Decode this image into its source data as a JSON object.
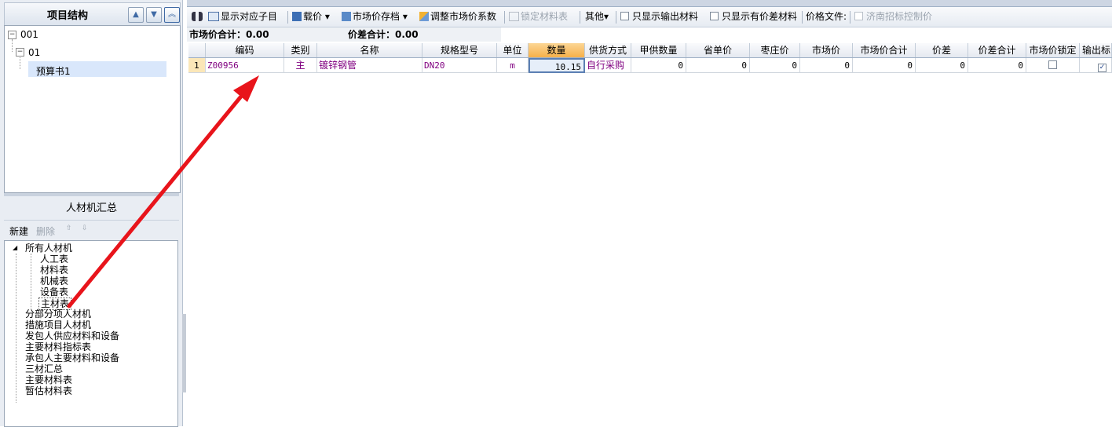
{
  "left_panel": {
    "project_header": "项目结构",
    "tree": [
      {
        "label": "001"
      },
      {
        "label": "01"
      },
      {
        "label": "预算书1"
      }
    ],
    "summary_header": "人材机汇总",
    "actions": {
      "new": "新建",
      "delete": "删除"
    },
    "summary_tree": {
      "root": "所有人材机",
      "children": [
        "人工表",
        "材料表",
        "机械表",
        "设备表",
        "主材表"
      ],
      "others": [
        "分部分项人材机",
        "措施项目人材机",
        "发包人供应材料和设备",
        "主要材料指标表",
        "承包人主要材料和设备",
        "三材汇总",
        "主要材料表",
        "暂估材料表"
      ]
    }
  },
  "toolbar": {
    "show_sub": "显示对应子目",
    "load_price": "载价",
    "market_archive": "市场价存档",
    "adjust_coef": "调整市场价系数",
    "lock_table": "锁定材料表",
    "other": "其他",
    "only_output": "只显示输出材料",
    "only_diff": "只显示有价差材料",
    "price_file": "价格文件:",
    "jinan": "济南招标控制价"
  },
  "summary": {
    "market_total": "市场价合计：0.00",
    "diff_total": "价差合计：0.00"
  },
  "table": {
    "columns": [
      "编码",
      "类别",
      "名称",
      "规格型号",
      "单位",
      "数量",
      "供货方式",
      "甲供数量",
      "省单价",
      "枣庄价",
      "市场价",
      "市场价合计",
      "价差",
      "价差合计",
      "市场价锁定",
      "输出标"
    ],
    "rows": [
      {
        "index": "1",
        "code": "Z00956",
        "type": "主",
        "name": "镀锌钢管",
        "spec": "DN20",
        "unit": "m",
        "qty": "10.15",
        "supply": "自行采购",
        "owner_qty": "0",
        "prov_price": "0",
        "zz_price": "0",
        "market_price": "0",
        "market_total": "0",
        "diff": "0",
        "diff_total": "0",
        "locked": false,
        "output": true
      }
    ]
  },
  "colors": {
    "arrow": "#e8141b",
    "header_qty": "#f6b04a",
    "selected": "#d9e7fb"
  }
}
